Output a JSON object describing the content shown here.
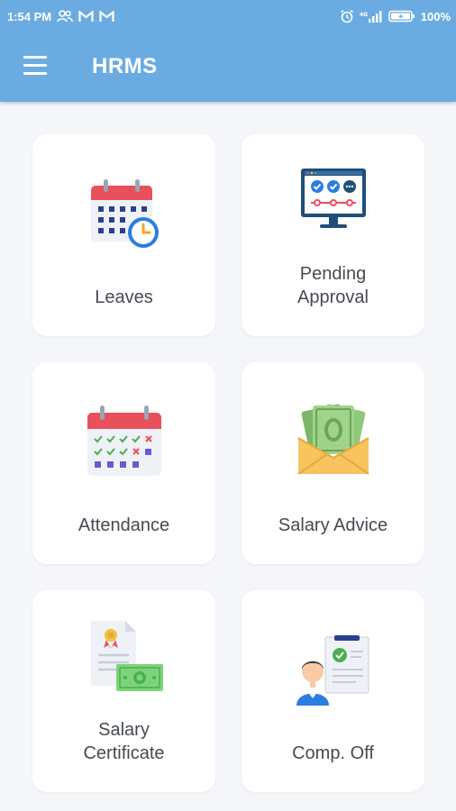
{
  "status_bar": {
    "time": "1:54 PM",
    "battery": "100%"
  },
  "app_bar": {
    "title": "HRMS"
  },
  "menu_cards": [
    {
      "label": "Leaves",
      "icon": "calendar-clock-icon"
    },
    {
      "label": "Pending Approval",
      "line1": "Pending",
      "line2": "Approval",
      "icon": "monitor-approval-icon"
    },
    {
      "label": "Attendance",
      "icon": "calendar-check-icon"
    },
    {
      "label": "Salary Advice",
      "icon": "money-envelope-icon"
    },
    {
      "label": "Salary Certificate",
      "line1": "Salary",
      "line2": "Certificate",
      "icon": "certificate-cash-icon"
    },
    {
      "label": "Comp. Off",
      "icon": "person-document-icon"
    }
  ],
  "colors": {
    "primary": "#6aace2",
    "background": "#f4f6f9",
    "card": "#ffffff",
    "label": "#454a52"
  }
}
